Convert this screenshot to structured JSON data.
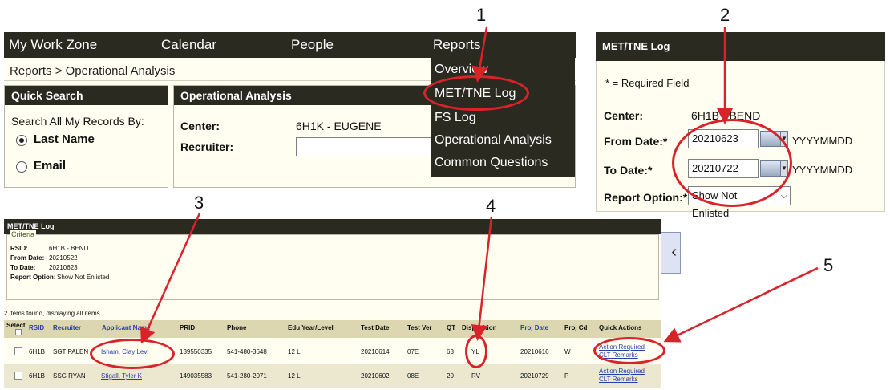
{
  "nav": {
    "items": [
      "My Work Zone",
      "Calendar",
      "People",
      "Reports"
    ]
  },
  "breadcrumb": "Reports > Operational Analysis",
  "quick_search": {
    "title": "Quick Search",
    "prompt": "Search All My Records By:",
    "options": [
      "Last Name",
      "Email"
    ],
    "selected": "Last Name"
  },
  "operational_analysis": {
    "title": "Operational Analysis",
    "center_label": "Center:",
    "center_value": "6H1K - EUGENE",
    "recruiter_label": "Recruiter:"
  },
  "reports_menu": {
    "items": [
      "Overview",
      "MET/TNE Log",
      "FS Log",
      "Operational Analysis",
      "Common Questions"
    ]
  },
  "met_form": {
    "title": "MET/TNE Log",
    "required_note": "* = Required Field",
    "center_label": "Center:",
    "center_value": "6H1B - BEND",
    "from_label": "From Date:*",
    "from_value": "20210623",
    "to_label": "To Date:*",
    "to_value": "20210722",
    "date_format": "YYYYMMDD",
    "report_option_label": "Report Option:*",
    "report_option_value": "Show Not Enlisted"
  },
  "report": {
    "title": "MET/TNE Log",
    "criteria_title": "Criteria",
    "criteria": [
      {
        "label": "RSID:",
        "value": "6H1B - BEND"
      },
      {
        "label": "From Date:",
        "value": "20210522"
      },
      {
        "label": "To Date:",
        "value": "20210623"
      },
      {
        "label": "Report Option:",
        "value": "Show Not Enlisted"
      }
    ],
    "summary": "2 items found, displaying all items.",
    "columns": {
      "select": "Select",
      "rsid": "RSID",
      "recruiter": "Recruiter",
      "applicant": "Applicant Name",
      "prid": "PRID",
      "phone": "Phone",
      "edu": "Edu Year/Level",
      "test_date": "Test Date",
      "test_ver": "Test Ver",
      "qt": "QT",
      "disposition": "Disposition",
      "proj_date": "Proj Date",
      "proj_cd": "Proj Cd",
      "quick_actions": "Quick Actions"
    },
    "rows": [
      {
        "rsid": "6H1B",
        "recruiter": "SGT PALEN",
        "applicant": "Isham, Clay Levi",
        "prid": "139550335",
        "phone": "541-480-3648",
        "edu": "12 L",
        "test_date": "20210614",
        "test_ver": "07E",
        "qt": "63",
        "disposition": "YL",
        "proj_date": "20210616",
        "proj_cd": "W",
        "action1": "Action Required",
        "action2": "CLT Remarks"
      },
      {
        "rsid": "6H1B",
        "recruiter": "SSG RYAN",
        "applicant": "Stigall, Tyler K",
        "prid": "149035583",
        "phone": "541-280-2071",
        "edu": "12 L",
        "test_date": "20210602",
        "test_ver": "08E",
        "qt": "20",
        "disposition": "RV",
        "proj_date": "20210729",
        "proj_cd": "P",
        "action1": "Action Required",
        "action2": "CLT Remarks"
      }
    ]
  },
  "steps": [
    "1",
    "2",
    "3",
    "4",
    "5"
  ],
  "accent_color": "#d8232a"
}
